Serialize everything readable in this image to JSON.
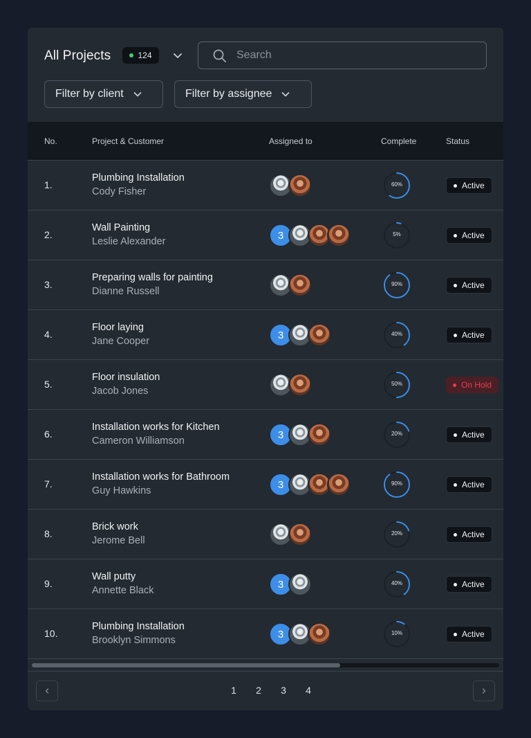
{
  "header": {
    "title": "All Projects",
    "count": "124",
    "search_placeholder": "Search",
    "filter_client": "Filter by client",
    "filter_assignee": "Filter by assignee"
  },
  "columns": {
    "no": "No.",
    "project": "Project & Customer",
    "assigned": "Assigned to",
    "complete": "Complete",
    "status": "Status"
  },
  "colors": {
    "accent": "#3d8ee8",
    "active_dot": "#3fcf6a",
    "hold": "#e0414f"
  },
  "rows": [
    {
      "no": "1.",
      "name": "Plumbing Installation",
      "customer": "Cody Fisher",
      "extra": "",
      "avatars": [
        "p1",
        "p2"
      ],
      "complete": 60,
      "complete_label": "60%",
      "status": "Active"
    },
    {
      "no": "2.",
      "name": "Wall Painting",
      "customer": "Leslie Alexander",
      "extra": "3",
      "avatars": [
        "p1",
        "p2",
        "p2"
      ],
      "complete": 5,
      "complete_label": "5%",
      "status": "Active"
    },
    {
      "no": "3.",
      "name": "Preparing walls for painting",
      "customer": "Dianne Russell",
      "extra": "",
      "avatars": [
        "p1",
        "p2"
      ],
      "complete": 90,
      "complete_label": "90%",
      "status": "Active"
    },
    {
      "no": "4.",
      "name": "Floor laying",
      "customer": "Jane Cooper",
      "extra": "3",
      "avatars": [
        "p1",
        "p2"
      ],
      "complete": 40,
      "complete_label": "40%",
      "status": "Active"
    },
    {
      "no": "5.",
      "name": "Floor insulation",
      "customer": "Jacob Jones",
      "extra": "",
      "avatars": [
        "p1",
        "p2"
      ],
      "complete": 50,
      "complete_label": "50%",
      "status": "On Hold"
    },
    {
      "no": "6.",
      "name": "Installation works for Kitchen",
      "customer": "Cameron Williamson",
      "extra": "3",
      "avatars": [
        "p1",
        "p2"
      ],
      "complete": 20,
      "complete_label": "20%",
      "status": "Active"
    },
    {
      "no": "7.",
      "name": "Installation works for Bathroom",
      "customer": "Guy Hawkins",
      "extra": "3",
      "avatars": [
        "p1",
        "p2",
        "p2"
      ],
      "complete": 90,
      "complete_label": "90%",
      "status": "Active"
    },
    {
      "no": "8.",
      "name": "Brick work",
      "customer": "Jerome Bell",
      "extra": "",
      "avatars": [
        "p1",
        "p2"
      ],
      "complete": 20,
      "complete_label": "20%",
      "status": "Active"
    },
    {
      "no": "9.",
      "name": "Wall putty",
      "customer": "Annette Black",
      "extra": "3",
      "avatars": [
        "p1"
      ],
      "complete": 40,
      "complete_label": "40%",
      "status": "Active"
    },
    {
      "no": "10.",
      "name": "Plumbing Installation",
      "customer": "Brooklyn Simmons",
      "extra": "3",
      "avatars": [
        "p1",
        "p2"
      ],
      "complete": 10,
      "complete_label": "10%",
      "status": "Active"
    }
  ],
  "pagination": {
    "pages": [
      "1",
      "2",
      "3",
      "4"
    ],
    "prev_icon": "chevron-left-icon",
    "next_icon": "chevron-right-icon"
  },
  "scroll": {
    "thumb_fraction": 0.66
  }
}
